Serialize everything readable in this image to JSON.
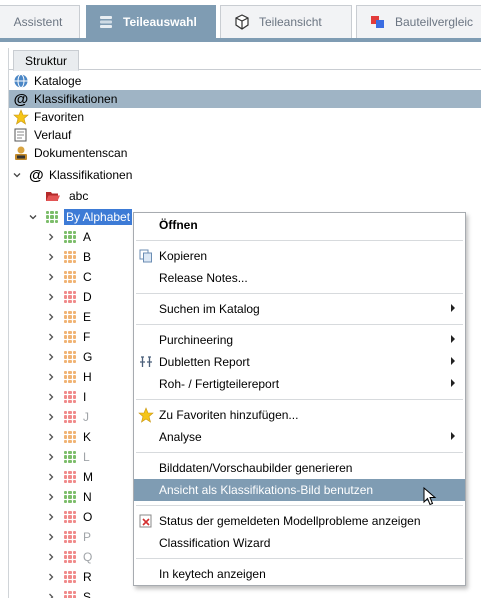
{
  "tabs": [
    {
      "label": "Assistent",
      "icon": "none"
    },
    {
      "label": "Teileauswahl",
      "icon": "parts-stack-icon",
      "active": true
    },
    {
      "label": "Teileansicht",
      "icon": "cube-icon"
    },
    {
      "label": "Bauteilvergleic",
      "icon": "compare-icon"
    }
  ],
  "subtab": {
    "label": "Struktur"
  },
  "nav": [
    {
      "label": "Kataloge",
      "icon": "catalog-icon"
    },
    {
      "label": "Klassifikationen",
      "icon": "at-icon",
      "selected": true
    },
    {
      "label": "Favoriten",
      "icon": "star-icon"
    },
    {
      "label": "Verlauf",
      "icon": "history-icon"
    },
    {
      "label": "Dokumentenscan",
      "icon": "docscan-icon"
    }
  ],
  "tree": {
    "root": {
      "label": "Klassifikationen",
      "icon": "at-icon"
    },
    "abc": {
      "label": "abc",
      "icon": "folder-open-icon"
    },
    "by_alphabet": {
      "label": "By Alphabet",
      "icon": "grid-icon"
    },
    "letters": [
      {
        "label": "A",
        "color": "green",
        "grey": false
      },
      {
        "label": "B",
        "color": "orange",
        "grey": false
      },
      {
        "label": "C",
        "color": "orange",
        "grey": false
      },
      {
        "label": "D",
        "color": "red",
        "grey": false
      },
      {
        "label": "E",
        "color": "orange",
        "grey": false
      },
      {
        "label": "F",
        "color": "orange",
        "grey": false
      },
      {
        "label": "G",
        "color": "orange",
        "grey": false
      },
      {
        "label": "H",
        "color": "orange",
        "grey": false
      },
      {
        "label": "I",
        "color": "red",
        "grey": false
      },
      {
        "label": "J",
        "color": "red",
        "grey": true
      },
      {
        "label": "K",
        "color": "orange",
        "grey": false
      },
      {
        "label": "L",
        "color": "green",
        "grey": true
      },
      {
        "label": "M",
        "color": "red",
        "grey": false
      },
      {
        "label": "N",
        "color": "green",
        "grey": false
      },
      {
        "label": "O",
        "color": "red",
        "grey": false
      },
      {
        "label": "P",
        "color": "red",
        "grey": true
      },
      {
        "label": "Q",
        "color": "red",
        "grey": true
      },
      {
        "label": "R",
        "color": "red",
        "grey": false
      },
      {
        "label": "S",
        "color": "red",
        "grey": false
      }
    ]
  },
  "menu": {
    "items": [
      {
        "label": "Öffnen",
        "bold": true
      },
      {
        "label": "Kopieren",
        "icon": "copy-icon"
      },
      {
        "label": "Release Notes..."
      },
      {
        "label": "Suchen im Katalog",
        "submenu": true
      },
      {
        "label": "Purchineering",
        "submenu": true
      },
      {
        "label": "Dubletten Report",
        "icon": "duplicates-icon",
        "submenu": true
      },
      {
        "label": "Roh- / Fertigteilereport",
        "submenu": true
      },
      {
        "label": "Zu Favoriten hinzufügen...",
        "icon": "star-icon"
      },
      {
        "label": "Analyse",
        "submenu": true
      },
      {
        "label": "Bilddaten/Vorschaubilder generieren"
      },
      {
        "label": "Ansicht als Klassifikations-Bild benutzen",
        "highlighted": true
      },
      {
        "label": "Status der gemeldeten Modellprobleme anzeigen",
        "icon": "problem-report-icon"
      },
      {
        "label": "Classification Wizard"
      },
      {
        "label": "In keytech anzeigen"
      }
    ]
  },
  "colors": {
    "accent": "#7f9cb3",
    "selection": "#9fb4c5",
    "grid_green": "#7cbd6a",
    "grid_orange": "#f0b373",
    "grid_red": "#f08a8a"
  }
}
